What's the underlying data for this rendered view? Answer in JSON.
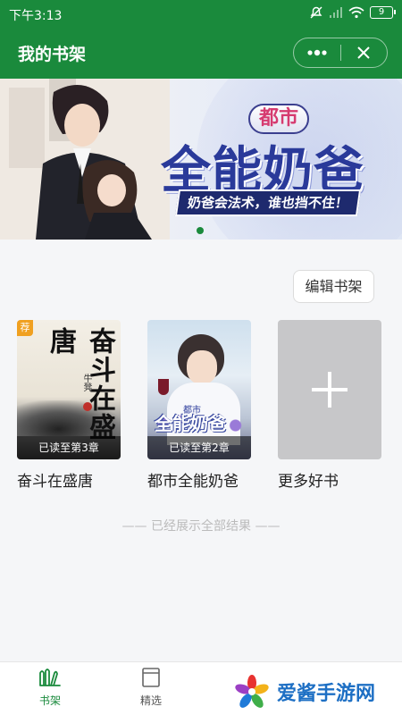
{
  "status_bar": {
    "time": "下午3:13",
    "battery": "9"
  },
  "header": {
    "title": "我的书架"
  },
  "banner": {
    "tag": "都市",
    "title": "全能奶爸",
    "slogan": "奶爸会法术，谁也挡不住！"
  },
  "edit_button": "编辑书架",
  "books": [
    {
      "title": "奋斗在盛唐",
      "cover_title": "奋斗在盛唐",
      "cover_author": "牛凳",
      "progress": "已读至第3章",
      "badge": "荐"
    },
    {
      "title": "都市全能奶爸",
      "cover_sub": "都市",
      "cover_title": "全能奶爸",
      "progress": "已读至第2章"
    },
    {
      "title": "更多好书"
    }
  ],
  "end_text": "—— 已经展示全部结果 ——",
  "bottom_nav": [
    {
      "label": "书架",
      "icon": "bookshelf-icon",
      "active": true
    },
    {
      "label": "精选",
      "icon": "picks-icon",
      "active": false
    }
  ],
  "watermark": {
    "text": "爱酱手游网"
  },
  "colors": {
    "brand_green": "#1a8a3c",
    "text_dark": "#222222",
    "muted": "#bbbbbb"
  }
}
